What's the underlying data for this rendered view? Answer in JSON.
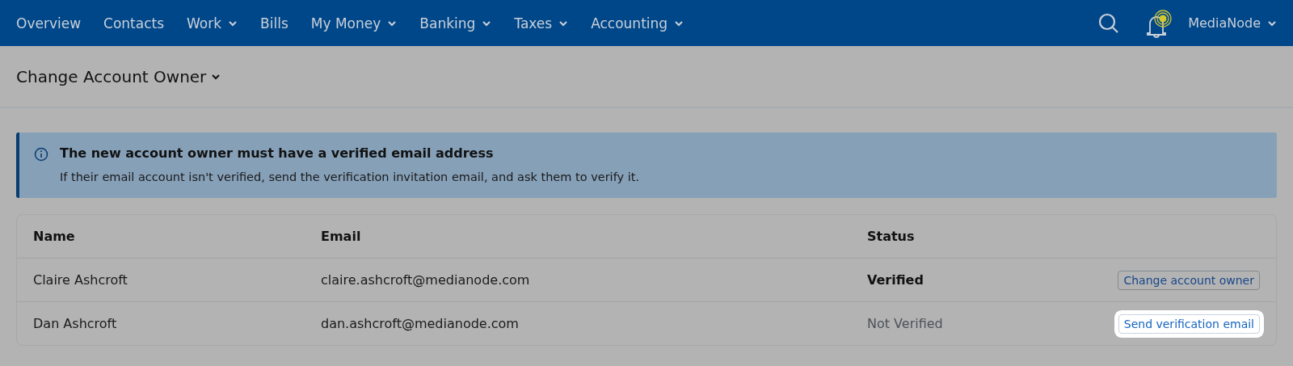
{
  "nav": {
    "items": [
      {
        "label": "Overview",
        "dropdown": false
      },
      {
        "label": "Contacts",
        "dropdown": false
      },
      {
        "label": "Work",
        "dropdown": true
      },
      {
        "label": "Bills",
        "dropdown": false
      },
      {
        "label": "My Money",
        "dropdown": true
      },
      {
        "label": "Banking",
        "dropdown": true
      },
      {
        "label": "Taxes",
        "dropdown": true
      },
      {
        "label": "Accounting",
        "dropdown": true
      }
    ],
    "account": "MediaNode",
    "notification": true
  },
  "page": {
    "title": "Change Account Owner"
  },
  "alert": {
    "title": "The new account owner must have a verified email address",
    "body": "If their email account isn't verified, send the verification invitation email, and ask them to verify it."
  },
  "table": {
    "columns": [
      "Name",
      "Email",
      "Status"
    ],
    "rows": [
      {
        "name": "Claire Ashcroft",
        "email": "claire.ashcroft@medianode.com",
        "status": "Verified",
        "verified": true,
        "action": "Change account owner",
        "highlighted": false
      },
      {
        "name": "Dan Ashcroft",
        "email": "dan.ashcroft@medianode.com",
        "status": "Not Verified",
        "verified": false,
        "action": "Send verification email",
        "highlighted": true
      }
    ]
  }
}
